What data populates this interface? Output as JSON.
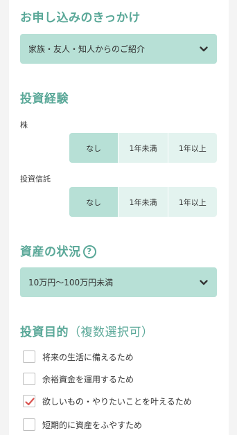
{
  "trigger": {
    "heading": "お申し込みのきっかけ",
    "selected": "家族・友人・知人からのご紹介"
  },
  "experience": {
    "heading": "投資経験",
    "stocks": {
      "label": "株",
      "options": [
        "なし",
        "1年未満",
        "1年以上"
      ],
      "selected": "なし"
    },
    "trusts": {
      "label": "投資信託",
      "options": [
        "なし",
        "1年未満",
        "1年以上"
      ],
      "selected": "なし"
    }
  },
  "assets": {
    "heading": "資産の状況",
    "help_symbol": "?",
    "selected": "10万円〜100万円未満"
  },
  "purpose": {
    "heading": "投資目的",
    "note": "（複数選択可）",
    "items": [
      {
        "label": "将来の生活に備えるため",
        "checked": false
      },
      {
        "label": "余裕資金を運用するため",
        "checked": false
      },
      {
        "label": "欲しいもの・やりたいことを叶えるため",
        "checked": true
      },
      {
        "label": "短期的に資産をふやすため",
        "checked": false
      }
    ]
  },
  "colors": {
    "accent": "#5aa898",
    "field_bg": "#b7e0d6",
    "option_bg": "#e3f3ef",
    "check_mark": "#d9534f"
  },
  "icons": {
    "dropdown": "chevron-down-icon",
    "help": "question-circle-icon",
    "checked": "checkmark-icon"
  }
}
